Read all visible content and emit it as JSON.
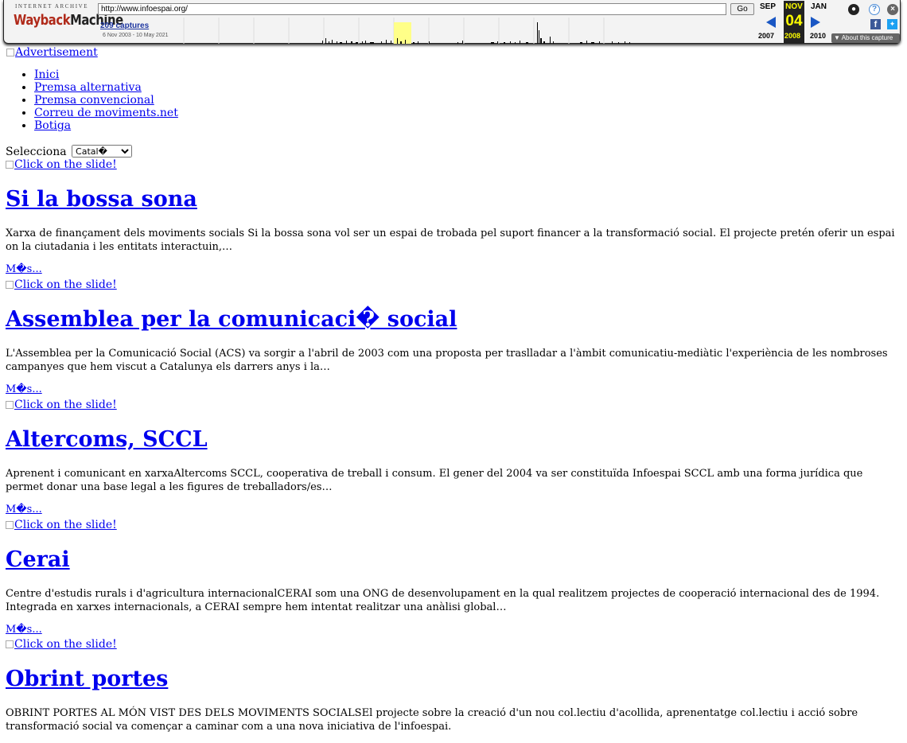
{
  "toolbar": {
    "ia_label": "INTERNET ARCHIVE",
    "logo_wayback": "Wayback",
    "logo_machine": "Machine",
    "url": "http://www.infoespai.org/",
    "go_label": "Go",
    "captures": "209 captures",
    "capture_range": "6 Nov 2003 - 10 May 2021",
    "month_prev": "SEP",
    "month_current": "NOV",
    "month_next": "JAN",
    "day": "04",
    "year_prev": "2007",
    "year_current": "2008",
    "year_next": "2010",
    "about_label": "About this capture",
    "colors": {
      "highlight": "#ffff00",
      "arrow": "#1a57c4"
    }
  },
  "ad_link": "Advertisement",
  "nav": [
    "Inici",
    "Premsa alternativa",
    "Premsa convencional",
    "Correu de moviments.net",
    "Botiga"
  ],
  "language": {
    "label": "Selecciona",
    "selected": "Catal�"
  },
  "slide_link": "Click on the slide!",
  "more_label": "M�s...",
  "articles": [
    {
      "title": "Si la bossa sona",
      "body": "Xarxa de finançament dels moviments socials Si la bossa sona vol ser un espai de trobada pel suport financer a la transformació social. El projecte pretén oferir un espai on la ciutadania i les entitats interactuin,…"
    },
    {
      "title": "Assemblea per la comunicaci� social",
      "body": "L'Assemblea per la Comunicació Social (ACS) va sorgir a l'abril de 2003 com una proposta per traslladar a l'àmbit comunicatiu-mediàtic l'experiència de les nombroses campanyes que hem viscut a Catalunya els darrers anys i la…"
    },
    {
      "title": "Altercoms, SCCL",
      "body": "Aprenent i comunicant en xarxaAltercoms SCCL, cooperativa de treball i consum. El gener del 2004 va ser constituïda Infoespai SCCL amb una forma jurídica que permet donar una base legal a les figures de treballadors/es…"
    },
    {
      "title": "Cerai",
      "body": "Centre d'estudis rurals i d'agricultura internacionalCERAI som una ONG de desenvolupament en la qual realitzem projectes de cooperació internacional des de 1994. Integrada en xarxes internacionals, a CERAI sempre hem intentat realitzar una anàlisi global…"
    },
    {
      "title": "Obrint portes",
      "body": "OBRINT PORTES AL MÓN VIST DES DELS MOVIMENTS SOCIALSEl projecte sobre la creació d'un nou col.lectiu d'acollida, aprenentatge col.lectiu i acció sobre transformació social va començar a caminar com a una nova iniciativa de l'infoespai."
    }
  ]
}
